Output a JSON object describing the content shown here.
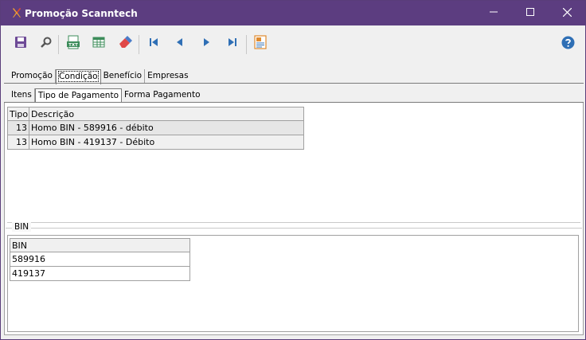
{
  "window": {
    "title": "Promoção Scanntech",
    "controls": {
      "minimize": "minimize-icon",
      "maximize": "maximize-icon",
      "close": "close-icon"
    },
    "accent": "#5c3d80"
  },
  "toolbar": {
    "buttons": [
      {
        "name": "save",
        "icon": "save-icon"
      },
      {
        "name": "search",
        "icon": "search-icon"
      },
      {
        "name": "export-txt",
        "icon": "txt-icon",
        "label": "TXT"
      },
      {
        "name": "grid",
        "icon": "grid-icon"
      },
      {
        "name": "clear",
        "icon": "eraser-icon"
      },
      {
        "name": "first",
        "icon": "first-record-icon"
      },
      {
        "name": "prev",
        "icon": "previous-record-icon"
      },
      {
        "name": "next",
        "icon": "next-record-icon"
      },
      {
        "name": "last",
        "icon": "last-record-icon"
      },
      {
        "name": "report",
        "icon": "report-icon"
      },
      {
        "name": "help",
        "icon": "help-icon"
      }
    ],
    "txt_label": "TXT"
  },
  "main_tabs": [
    "Promoção",
    "Condição",
    "Benefício",
    "Empresas"
  ],
  "main_tabs_active": "Condição",
  "sub_tabs": [
    "Itens",
    "Tipo de Pagamento",
    "Forma Pagamento"
  ],
  "sub_tabs_active": "Tipo de Pagamento",
  "payment_grid": {
    "columns": [
      "Tipo",
      "Descrição"
    ],
    "rows": [
      {
        "tipo": "13",
        "descricao": "Homo BIN - 589916 - débito"
      },
      {
        "tipo": "13",
        "descricao": "Homo BIN - 419137 - Débito"
      }
    ]
  },
  "bin_group": {
    "legend": "BIN",
    "columns": [
      "BIN"
    ],
    "rows": [
      "589916",
      "419137"
    ]
  }
}
